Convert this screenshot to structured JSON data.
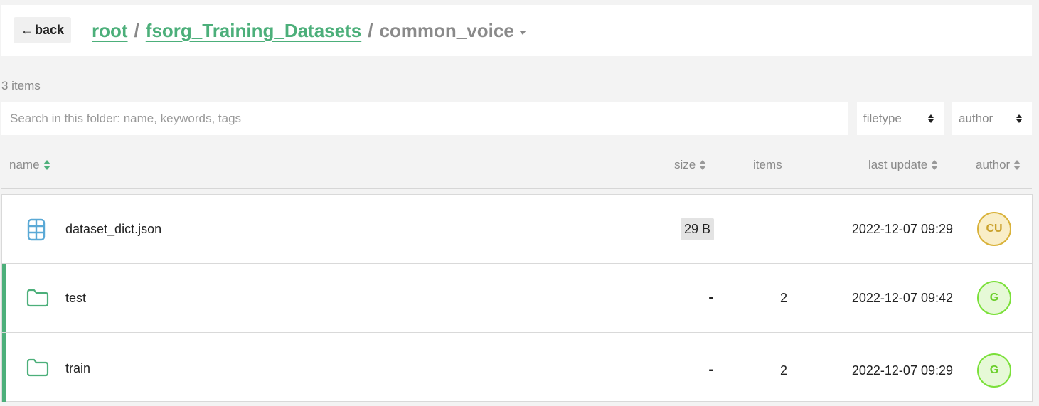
{
  "header": {
    "back_label": "back",
    "breadcrumb": {
      "root": "root",
      "parent": "fsorg_Training_Datasets",
      "current": "common_voice",
      "separator": "/"
    }
  },
  "items_count": "3 items",
  "search": {
    "placeholder": "Search in this folder: name, keywords, tags",
    "value": ""
  },
  "filters": {
    "filetype": "filetype",
    "author": "author"
  },
  "columns": {
    "name": "name",
    "size": "size",
    "items": "items",
    "last_update": "last update",
    "author": "author"
  },
  "rows": [
    {
      "type": "file",
      "icon": "table-file-icon",
      "name": "dataset_dict.json",
      "size": "29 B",
      "items": "",
      "last_update": "2022-12-07 09:29",
      "author_initials": "CU"
    },
    {
      "type": "folder",
      "icon": "folder-icon",
      "name": "test",
      "size": "-",
      "items": "2",
      "last_update": "2022-12-07 09:42",
      "author_initials": "G"
    },
    {
      "type": "folder",
      "icon": "folder-icon",
      "name": "train",
      "size": "-",
      "items": "2",
      "last_update": "2022-12-07 09:29",
      "author_initials": "G"
    }
  ],
  "colors": {
    "accent": "#4caf7a",
    "file_icon": "#5aa9d6",
    "avatar_cu_bg": "#f9eec8",
    "avatar_cu_border": "#d9b23a",
    "avatar_g_bg": "#e6f9d7",
    "avatar_g_border": "#7be03a"
  }
}
